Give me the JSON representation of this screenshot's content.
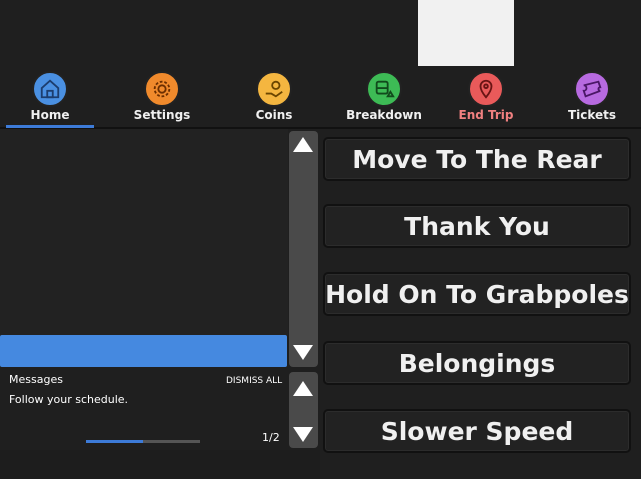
{
  "nav": {
    "items": [
      {
        "label": "Home",
        "icon": "home-icon",
        "color": "#4a90e2"
      },
      {
        "label": "Settings",
        "icon": "gear-icon",
        "color": "#f08a2c"
      },
      {
        "label": "Coins",
        "icon": "coins-icon",
        "color": "#f4b640"
      },
      {
        "label": "Breakdown",
        "icon": "bus-icon",
        "color": "#3dbb55"
      },
      {
        "label": "End Trip",
        "icon": "map-pin-icon",
        "color": "#e95a5a"
      },
      {
        "label": "Tickets",
        "icon": "ticket-icon",
        "color": "#b76ae0"
      }
    ]
  },
  "messages": {
    "title": "Messages",
    "dismiss_all": "DISMISS ALL",
    "body": "Follow your schedule.",
    "page": "1/2",
    "progress": 0.5
  },
  "actions": [
    {
      "label": "Move To The Rear"
    },
    {
      "label": "Thank You"
    },
    {
      "label": "Hold On To Grabpoles"
    },
    {
      "label": "Belongings"
    },
    {
      "label": "Slower Speed"
    }
  ]
}
